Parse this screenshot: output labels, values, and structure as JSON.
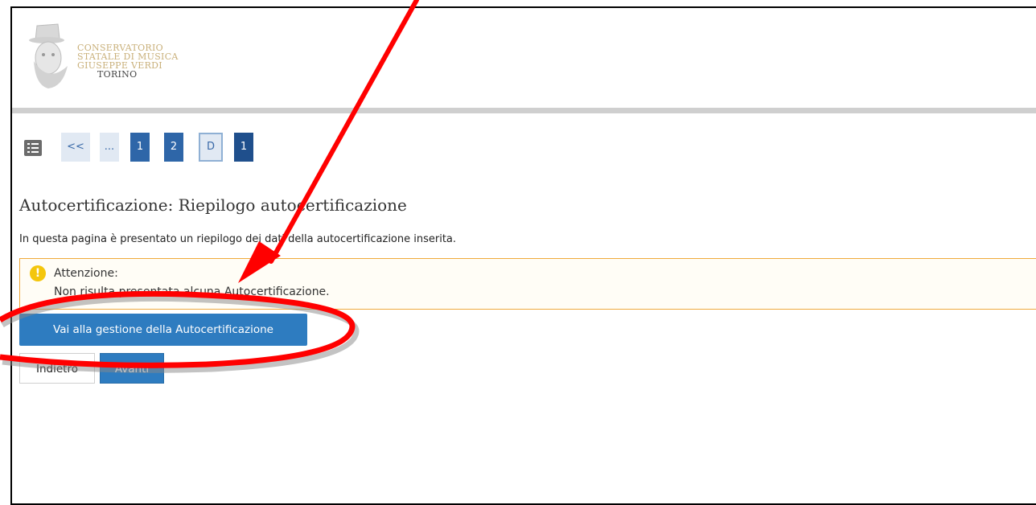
{
  "logo": {
    "lines": [
      "CONSERVATORIO",
      "STATALE DI MUSICA",
      "GIUSEPPE VERDI",
      "TORINO"
    ],
    "icon": "portrait-logo-icon"
  },
  "pager": {
    "list_icon": "list-icon",
    "prev": "<<",
    "ellipsis": "...",
    "step1": "1",
    "step2": "2",
    "stepD": "D",
    "current": "1"
  },
  "page": {
    "title": "Autocertificazione: Riepilogo autocertificazione",
    "description": "In questa pagina è presentato un riepilogo dei dati della autocertificazione inserita."
  },
  "warning": {
    "icon": "warning-icon",
    "title": "Attenzione:",
    "message": "Non risulta presentata alcuna Autocertificazione."
  },
  "buttons": {
    "manage": "Vai alla gestione della Autocertificazione",
    "back": "Indietro",
    "next": "Avanti"
  },
  "colors": {
    "primary": "#2e7cc0",
    "pager_active": "#2e66a8",
    "warning_border": "#f0a93b",
    "annotation": "#ff0000"
  }
}
